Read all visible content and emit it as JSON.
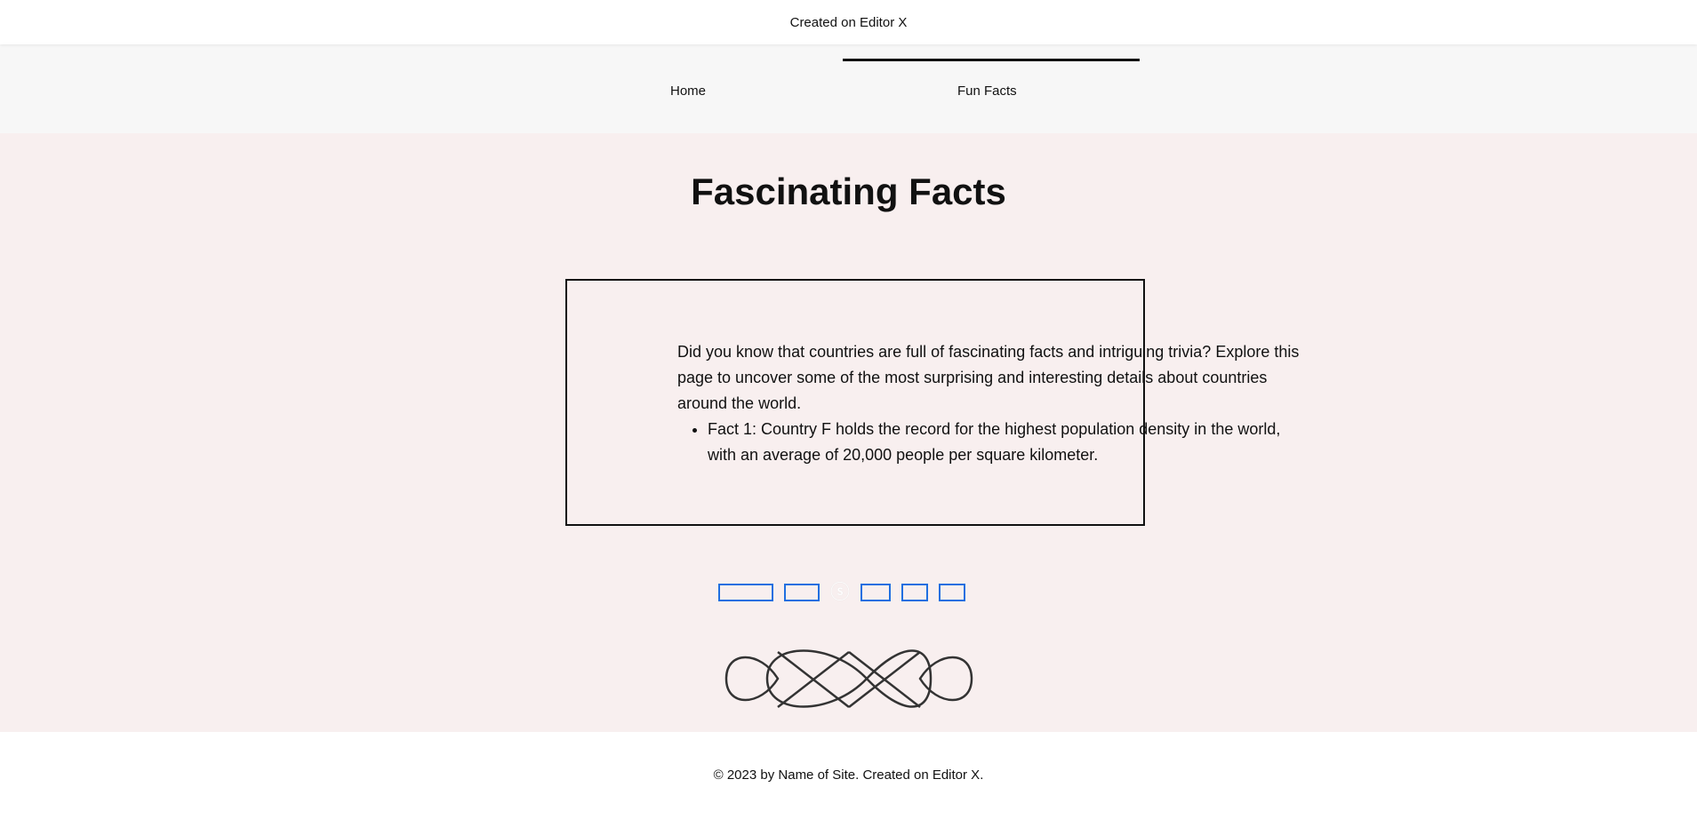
{
  "banner": {
    "part1": "Created",
    "part2": " on Editor",
    "part3": " X"
  },
  "nav": {
    "items": [
      {
        "label": "Home",
        "active": false
      },
      {
        "label": "Fun Facts",
        "active": true
      }
    ]
  },
  "main": {
    "title": "Fascinating Facts",
    "intro": "Did you know that countries are full of fascinating facts and intriguing trivia? Explore this page to uncover some of the most surprising and interesting details about countries around the world.",
    "facts": [
      "Fact 1: Country F holds the record for the highest population density in the world, with an average of 20,000 people per square kilometer."
    ]
  },
  "social": {
    "icons": [
      "social-link-1",
      "social-link-2",
      "social-link-3",
      "social-link-4",
      "social-link-5"
    ]
  },
  "footer": {
    "part1": "© 2023 by Name of Site",
    "part2": ". Created on Editor",
    "part3": " X."
  },
  "colors": {
    "page_bg": "#f8efef",
    "nav_bg": "#f7f7f7",
    "accent_border": "#1f6fe0",
    "text": "#111111"
  }
}
